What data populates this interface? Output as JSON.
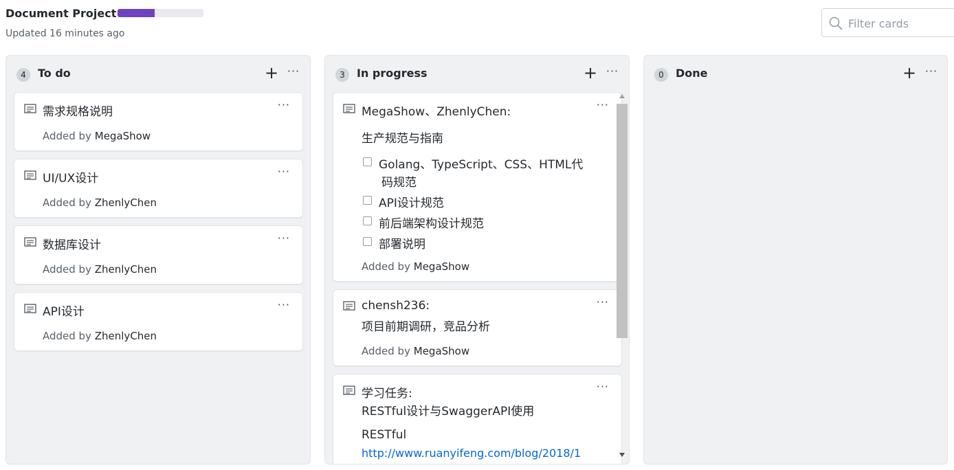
{
  "project": {
    "title": "Document Project",
    "progress_percent": 43,
    "progress_color": "#6f42c1",
    "updated": "Updated 16 minutes ago"
  },
  "filter": {
    "placeholder": "Filter cards",
    "icon": "search-icon"
  },
  "columns": [
    {
      "count": "4",
      "name": "To do",
      "cards": [
        {
          "title": "需求规格说明",
          "added_prefix": "Added by",
          "author": "MegaShow"
        },
        {
          "title": "UI/UX设计",
          "added_prefix": "Added by",
          "author": "ZhenlyChen"
        },
        {
          "title": "数据库设计",
          "added_prefix": "Added by",
          "author": "ZhenlyChen"
        },
        {
          "title": "API设计",
          "added_prefix": "Added by",
          "author": "ZhenlyChen"
        }
      ]
    },
    {
      "count": "3",
      "name": "In progress",
      "cards": [
        {
          "title": "MegaShow、ZhenlyChen:",
          "text": "生产规范与指南",
          "checklist": [
            {
              "line1": "Golang、TypeScript、CSS、HTML代",
              "line2": "码规范",
              "checked": false
            },
            {
              "line1": "API设计规范",
              "checked": false
            },
            {
              "line1": "前后端架构设计规范",
              "checked": false
            },
            {
              "line1": "部署说明",
              "checked": false
            }
          ],
          "added_prefix": "Added by",
          "author": "MegaShow"
        },
        {
          "title": "chensh236:",
          "text": "项目前期调研，竞品分析",
          "added_prefix": "Added by",
          "author": "MegaShow"
        },
        {
          "title": "学习任务:",
          "text": "RESTful设计与SwaggerAPI使用",
          "text2": "RESTful",
          "link": "http://www.ruanyifeng.com/blog/2018/1"
        }
      ]
    },
    {
      "count": "0",
      "name": "Done",
      "cards": []
    }
  ],
  "actions": {
    "add": "+",
    "more": "···"
  }
}
